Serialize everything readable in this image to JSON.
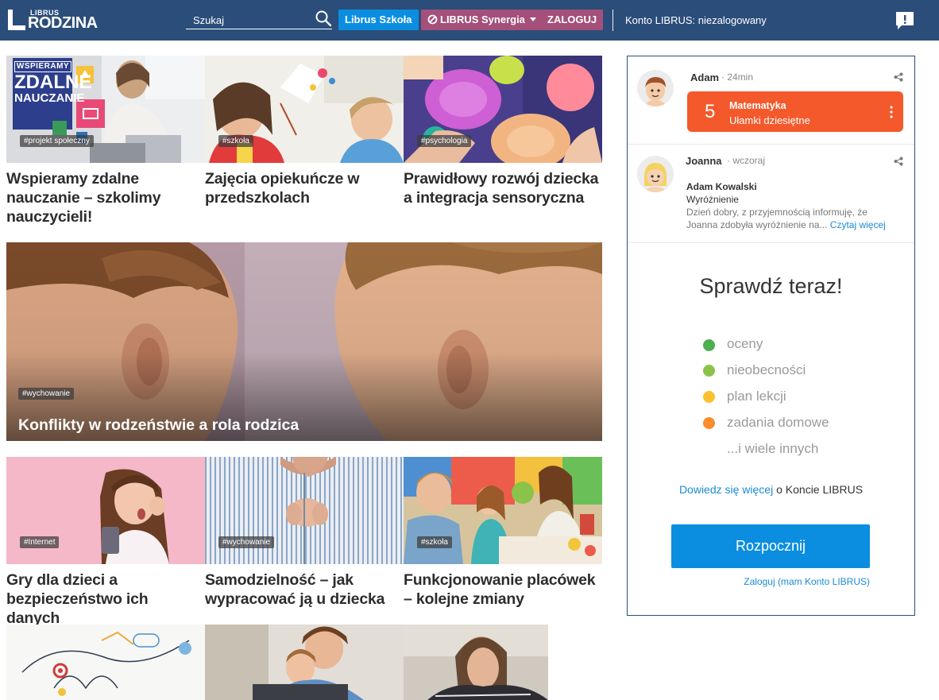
{
  "header": {
    "logo_top": "LIBRUS",
    "logo_main": "RODZINA",
    "search_placeholder": "Szukaj",
    "btn_szkola": "Librus Szkoła",
    "btn_synergia": "LIBRUS Synergia",
    "btn_login": "ZALOGUJ",
    "account_status": "Konto LIBRUS: niezalogowany"
  },
  "articles": [
    {
      "tag": "#projekt społeczny",
      "title_lines": [
        "Wspieramy zdalne",
        "nauczanie – szkolimy",
        "nauczycieli!"
      ],
      "thumb_text": [
        "WSPIERAMY",
        "ZDALNE",
        "NAUCZANIE"
      ]
    },
    {
      "tag": "#szkoła",
      "title_lines": [
        "Zajęcia opiekuńcze w",
        "przedszkolach"
      ]
    },
    {
      "tag": "#psychologia",
      "title_lines": [
        "Prawidłowy rozwój dziecka",
        "a integracja sensoryczna"
      ]
    },
    {
      "tag": "#Internet",
      "title_lines": [
        "Gry dla dzieci a",
        "bezpieczeństwo ich danych"
      ]
    },
    {
      "tag": "#wychowanie",
      "title_lines": [
        "Samodzielność – jak",
        "wypracować ją u dziecka"
      ]
    },
    {
      "tag": "#szkoła",
      "title_lines": [
        "Funkcjonowanie placówek",
        "– kolejne zmiany"
      ]
    }
  ],
  "hero": {
    "tag": "#wychowanie",
    "title": "Konflikty w rodzeństwie a rola rodzica"
  },
  "sidebar": {
    "notif1": {
      "sender": "Adam",
      "time": "· 24min",
      "grade": "5",
      "subject": "Matematyka",
      "topic": "Ułamki dziesiętne"
    },
    "notif2": {
      "sender": "Joanna",
      "time": "· wczoraj",
      "from": "Adam Kowalski",
      "subject": "Wyróżnienie",
      "body_line1": "Dzień dobry, z przyjemnością informuję, że",
      "body_line2": "Joanna zdobyła wyróżnienie na...",
      "more": "Czytaj więcej"
    },
    "promo_title": "Sprawdź teraz!",
    "features": [
      {
        "label": "oceny",
        "color": "#4caf50"
      },
      {
        "label": "nieobecności",
        "color": "#8bc34a"
      },
      {
        "label": "plan lekcji",
        "color": "#fbc02d"
      },
      {
        "label": "zadania domowe",
        "color": "#fb8c2e"
      },
      {
        "label": "...i wiele innych",
        "color": ""
      }
    ],
    "learn_link": "Dowiedz się więcej",
    "learn_rest": "o Koncie LIBRUS",
    "start_button": "Rozpocznij",
    "login_link": "Zaloguj (mam Konto LIBRUS)"
  }
}
